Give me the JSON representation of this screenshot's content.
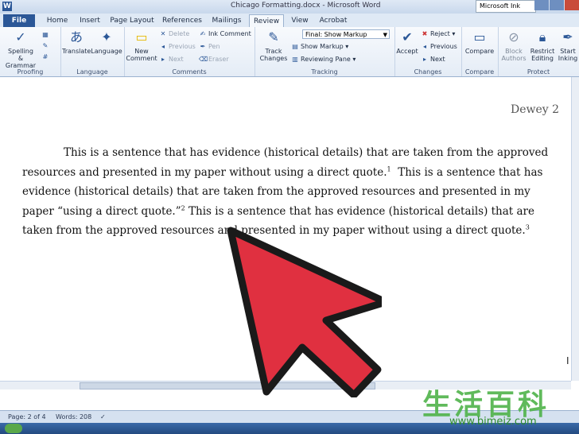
{
  "window": {
    "title": "Chicago Formatting.docx - Microsoft Word",
    "app_icon": "W",
    "account": "Microsoft Ink"
  },
  "tabs": [
    {
      "label": "File"
    },
    {
      "label": "Home"
    },
    {
      "label": "Insert"
    },
    {
      "label": "Page Layout"
    },
    {
      "label": "References"
    },
    {
      "label": "Mailings"
    },
    {
      "label": "Review"
    },
    {
      "label": "View"
    },
    {
      "label": "Acrobat"
    }
  ],
  "ribbon": {
    "proofing": {
      "name": "Proofing",
      "spelling": "Spelling &",
      "spelling2": "Grammar"
    },
    "language": {
      "name": "Language",
      "translate": "Translate",
      "language": "Language"
    },
    "comments": {
      "name": "Comments",
      "new": "New",
      "new2": "Comment",
      "delete": "Delete",
      "previous": "Previous",
      "next": "Next",
      "ink": "Ink Comment",
      "pen": "Pen",
      "eraser": "Eraser"
    },
    "tracking": {
      "name": "Tracking",
      "track": "Track",
      "track2": "Changes",
      "markup_select": "Final: Show Markup",
      "show_markup": "Show Markup",
      "reviewing_pane": "Reviewing Pane"
    },
    "changes": {
      "name": "Changes",
      "accept": "Accept",
      "reject": "Reject",
      "previous": "Previous",
      "next": "Next"
    },
    "compare": {
      "name": "Compare",
      "compare": "Compare"
    },
    "protect": {
      "name": "Protect",
      "block": "Block",
      "block2": "Authors",
      "restrict": "Restrict",
      "restrict2": "Editing",
      "start": "Start",
      "start2": "Inking"
    }
  },
  "document": {
    "header": "Dewey 2",
    "p1": "This is a sentence that has evidence (historical details) that are taken from the approved resources and presented in my paper without using a direct quote.",
    "fn1": "1",
    "p2": "This is a sentence that has evidence (historical details) that are taken from the approved resources and presented in my paper “using a direct quote.”",
    "fn2": "2",
    "p3": "This is a sentence that has evidence (historical details) that are taken from the approved resources and presented in my paper without using a direct quote.",
    "fn3": "3"
  },
  "status": {
    "page": "Page: 2 of 4",
    "words": "Words: 208"
  },
  "watermark": {
    "cjk": "生活百科",
    "url": "www.bimeiz.com"
  },
  "colors": {
    "accent": "#2b5797",
    "arrow": "#e03040",
    "watermark": "#4fb34a"
  }
}
